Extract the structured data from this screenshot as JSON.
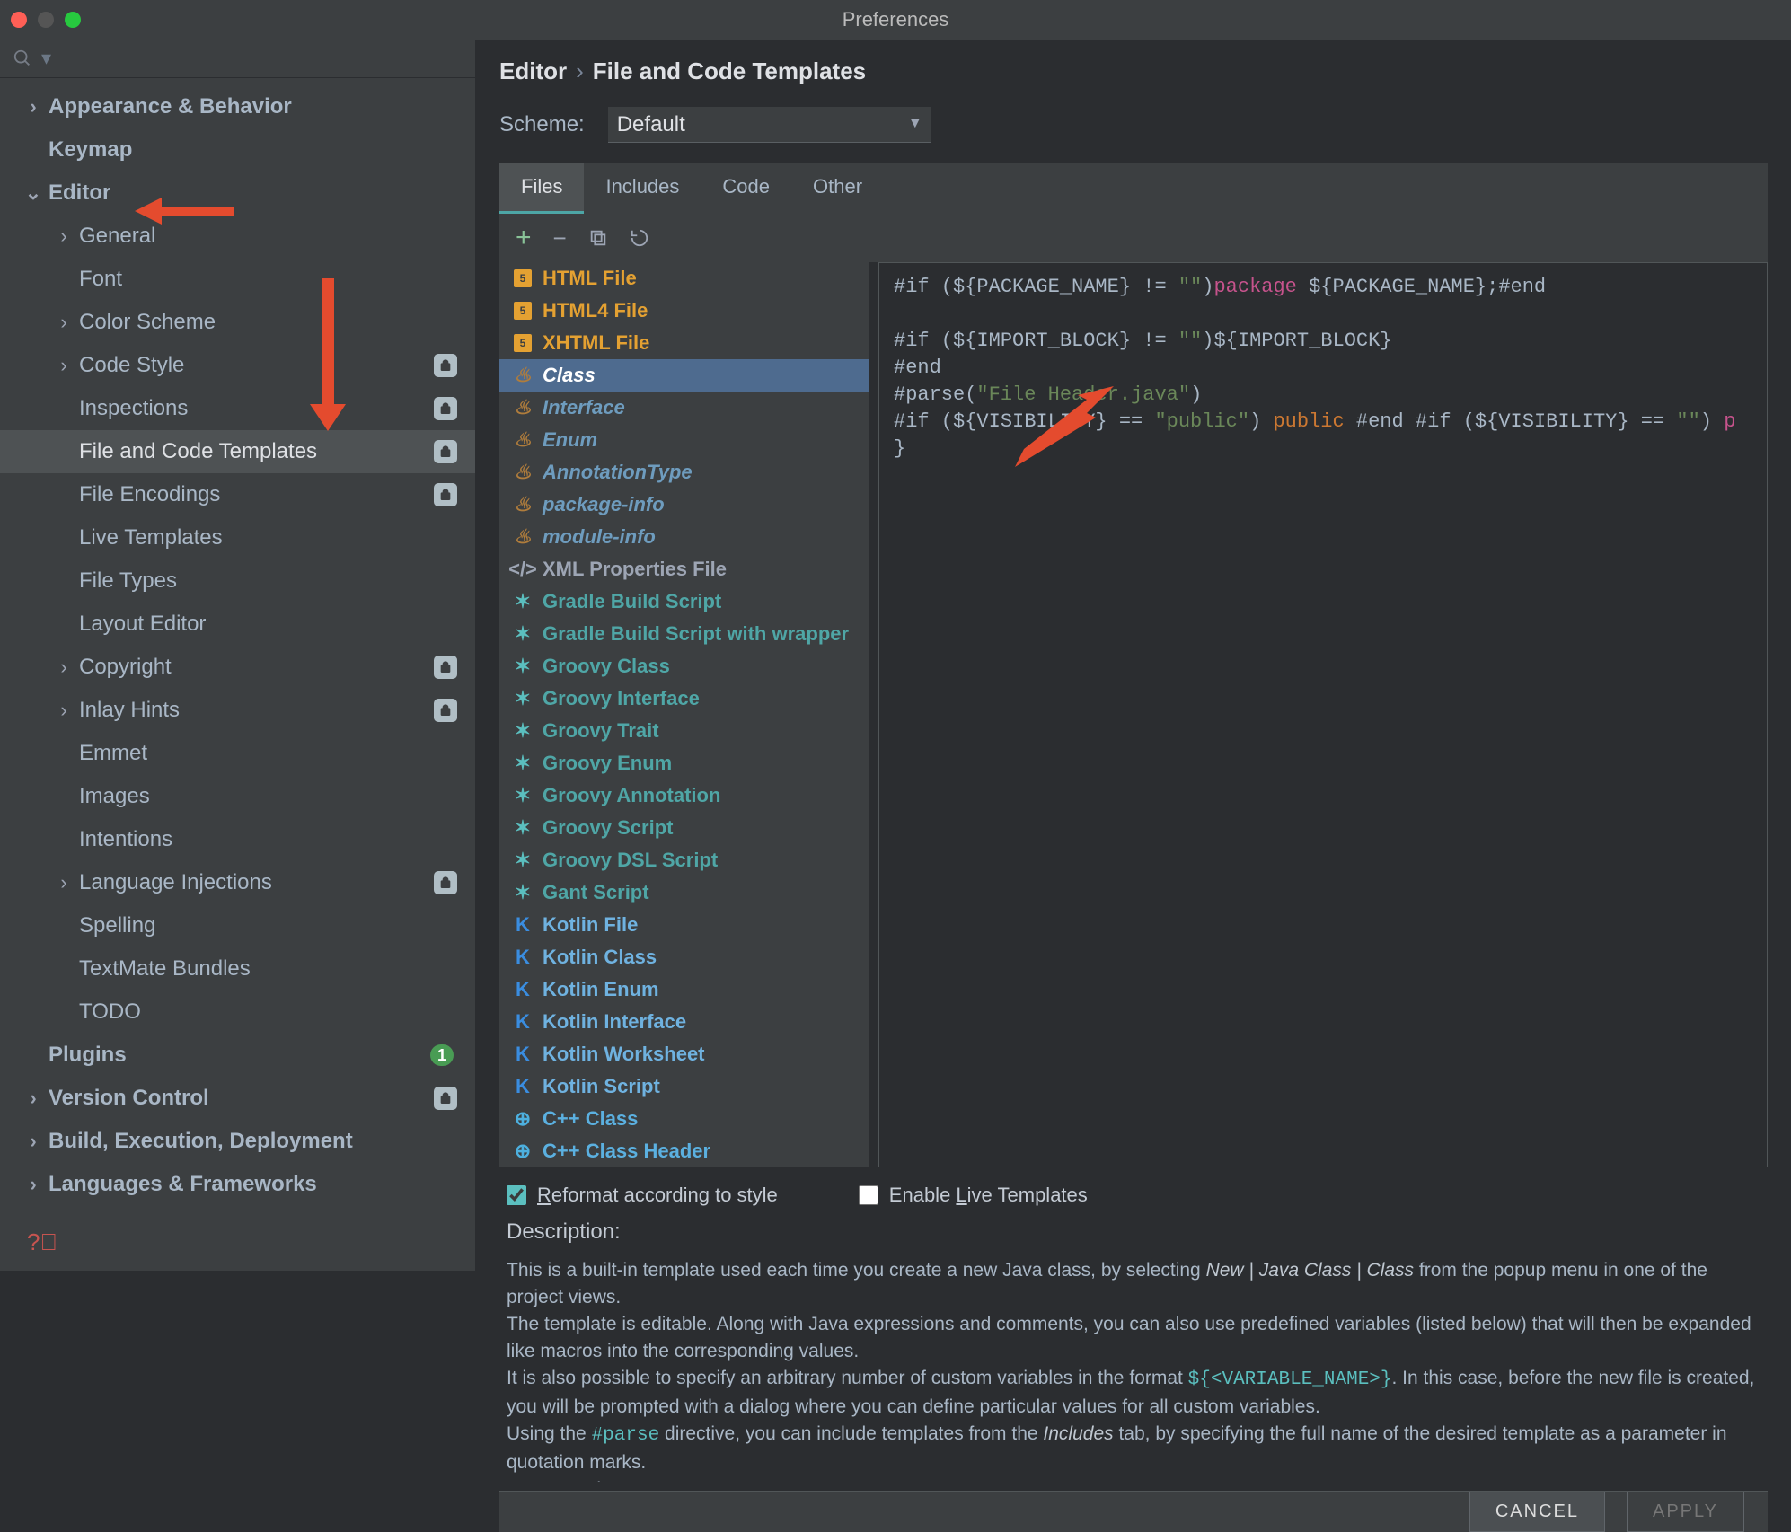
{
  "window": {
    "title": "Preferences"
  },
  "breadcrumb": {
    "a": "Editor",
    "b": "File and Code Templates"
  },
  "scheme": {
    "label": "Scheme:",
    "value": "Default"
  },
  "tabs": {
    "files": "Files",
    "includes": "Includes",
    "code": "Code",
    "other": "Other"
  },
  "sidebar": {
    "appearance": "Appearance & Behavior",
    "keymap": "Keymap",
    "editor": "Editor",
    "general": "General",
    "font": "Font",
    "color_scheme": "Color Scheme",
    "code_style": "Code Style",
    "inspections": "Inspections",
    "file_code_templates": "File and Code Templates",
    "file_encodings": "File Encodings",
    "live_templates": "Live Templates",
    "file_types": "File Types",
    "layout_editor": "Layout Editor",
    "copyright": "Copyright",
    "inlay_hints": "Inlay Hints",
    "emmet": "Emmet",
    "images": "Images",
    "intentions": "Intentions",
    "lang_inj": "Language Injections",
    "spelling": "Spelling",
    "textmate": "TextMate Bundles",
    "todo": "TODO",
    "plugins": "Plugins",
    "plugins_count": "1",
    "vcs": "Version Control",
    "build": "Build, Execution, Deployment",
    "lang_fw": "Languages & Frameworks"
  },
  "files": [
    {
      "label": "HTML File",
      "icon": "html",
      "cls": "c-html"
    },
    {
      "label": "HTML4 File",
      "icon": "html",
      "cls": "c-html"
    },
    {
      "label": "XHTML File",
      "icon": "html",
      "cls": "c-html"
    },
    {
      "label": "Class",
      "icon": "java",
      "cls": "c-java",
      "sel": true
    },
    {
      "label": "Interface",
      "icon": "java",
      "cls": "c-java"
    },
    {
      "label": "Enum",
      "icon": "java",
      "cls": "c-java"
    },
    {
      "label": "AnnotationType",
      "icon": "java",
      "cls": "c-java"
    },
    {
      "label": "package-info",
      "icon": "java",
      "cls": "c-java"
    },
    {
      "label": "module-info",
      "icon": "java",
      "cls": "c-java"
    },
    {
      "label": "XML Properties File",
      "icon": "xml",
      "cls": "c-xml"
    },
    {
      "label": "Gradle Build Script",
      "icon": "gro",
      "cls": "c-gro"
    },
    {
      "label": "Gradle Build Script with wrapper",
      "icon": "gro",
      "cls": "c-gro"
    },
    {
      "label": "Groovy Class",
      "icon": "gro",
      "cls": "c-gro"
    },
    {
      "label": "Groovy Interface",
      "icon": "gro",
      "cls": "c-gro"
    },
    {
      "label": "Groovy Trait",
      "icon": "gro",
      "cls": "c-gro"
    },
    {
      "label": "Groovy Enum",
      "icon": "gro",
      "cls": "c-gro"
    },
    {
      "label": "Groovy Annotation",
      "icon": "gro",
      "cls": "c-gro"
    },
    {
      "label": "Groovy Script",
      "icon": "gro",
      "cls": "c-gro"
    },
    {
      "label": "Groovy DSL Script",
      "icon": "gro",
      "cls": "c-gro"
    },
    {
      "label": "Gant Script",
      "icon": "gro",
      "cls": "c-gro"
    },
    {
      "label": "Kotlin File",
      "icon": "kot",
      "cls": "c-kot"
    },
    {
      "label": "Kotlin Class",
      "icon": "kot",
      "cls": "c-kot"
    },
    {
      "label": "Kotlin Enum",
      "icon": "kot",
      "cls": "c-kot"
    },
    {
      "label": "Kotlin Interface",
      "icon": "kot",
      "cls": "c-kot"
    },
    {
      "label": "Kotlin Worksheet",
      "icon": "kot",
      "cls": "c-kot"
    },
    {
      "label": "Kotlin Script",
      "icon": "kot",
      "cls": "c-kot"
    },
    {
      "label": "C++ Class",
      "icon": "cpp",
      "cls": "c-cpp"
    },
    {
      "label": "C++ Class Header",
      "icon": "cpp",
      "cls": "c-cpp"
    }
  ],
  "editor_lines": [
    [
      [
        "#if (${PACKAGE_NAME} != ",
        ""
      ],
      [
        "\"\"",
        "str"
      ],
      [
        ")",
        ""
      ],
      [
        "package",
        "kw2"
      ],
      [
        " ${PACKAGE_NAME};#end",
        ""
      ]
    ],
    [
      [
        "",
        ""
      ]
    ],
    [
      [
        "#if (${IMPORT_BLOCK} != ",
        ""
      ],
      [
        "\"\"",
        "str"
      ],
      [
        ")${IMPORT_BLOCK}",
        ""
      ]
    ],
    [
      [
        "#end",
        ""
      ]
    ],
    [
      [
        "#parse(",
        ""
      ],
      [
        "\"File Header.java\"",
        "str"
      ],
      [
        ")",
        ""
      ]
    ],
    [
      [
        "#if (${VISIBILITY} == ",
        ""
      ],
      [
        "\"public\"",
        "str"
      ],
      [
        ") ",
        ""
      ],
      [
        "public",
        "kw1"
      ],
      [
        " #end #if (${VISIBILITY} == ",
        ""
      ],
      [
        "\"\"",
        "str"
      ],
      [
        ") ",
        ""
      ],
      [
        "p",
        "kw2"
      ]
    ],
    [
      [
        "}",
        ""
      ]
    ]
  ],
  "checks": {
    "reformat": "Reformat according to style",
    "live": "Enable Live Templates"
  },
  "desc": {
    "title": "Description:",
    "t1a": "This is a built-in template used each time you create a new Java class, by selecting ",
    "t1b": "New | Java Class | Class",
    "t1c": " from the popup menu in one of the project views.",
    "t2": "The template is editable. Along with Java expressions and comments, you can also use predefined variables (listed below) that will then be expanded like macros into the corresponding values.",
    "t3a": "It is also possible to specify an arbitrary number of custom variables in the format ",
    "t3b": "${<VARIABLE_NAME>}",
    "t3c": ". In this case, before the new file is created, you will be prompted with a dialog where you can define particular values for all custom variables.",
    "t4a": "Using the ",
    "t4b": "#parse",
    "t4c": " directive, you can include templates from the ",
    "t4d": "Includes",
    "t4e": " tab, by specifying the full name of the desired template as a parameter in quotation marks.",
    "t5": "For example:"
  },
  "footer": {
    "cancel": "CANCEL",
    "apply": "APPLY"
  }
}
